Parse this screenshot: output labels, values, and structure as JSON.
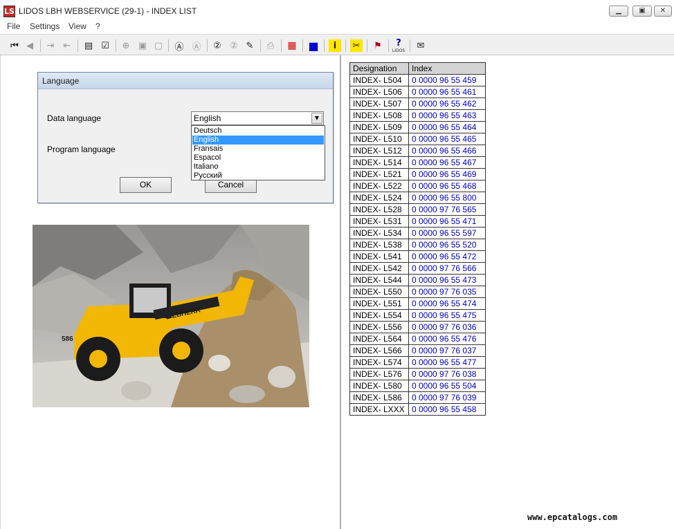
{
  "window": {
    "title": "LIDOS LBH WEBSERVICE (29-1) - INDEX LIST",
    "logo_text": "LS"
  },
  "menu": [
    "File",
    "Settings",
    "View",
    "?"
  ],
  "toolbar": {
    "icons": [
      "first-page-icon",
      "previous-page-icon",
      "export-icon",
      "import-icon",
      "cart-icon",
      "checklist-icon",
      "zoom-in-icon",
      "fit-page-icon",
      "page-icon",
      "find-a-icon",
      "find-next-icon",
      "goto-2-icon",
      "goto-alt-icon",
      "edit-icon",
      "print-icon",
      "grid-icon",
      "blue-square-icon",
      "info-icon",
      "tools-icon",
      "flag-icon",
      "lidos-help-icon",
      "mail-icon"
    ],
    "lidos_label": "LIDOS"
  },
  "dialog": {
    "title": "Language",
    "data_language_label": "Data language",
    "program_language_label": "Program language",
    "selected_value": "English",
    "options": [
      "Deutsch",
      "English",
      "Fransais",
      "Espacol",
      "Italiano",
      "Русский"
    ],
    "selected_index": 1,
    "ok_label": "OK",
    "cancel_label": "Cancel"
  },
  "photo": {
    "brand_text": "LIEBHERR",
    "model_text": "586"
  },
  "index_table": {
    "headers": [
      "Designation",
      "Index"
    ],
    "rows": [
      [
        "INDEX- L504",
        "0 0000 96 55 459"
      ],
      [
        "INDEX- L506",
        "0 0000 96 55 461"
      ],
      [
        "INDEX- L507",
        "0 0000 96 55 462"
      ],
      [
        "INDEX- L508",
        "0 0000 96 55 463"
      ],
      [
        "INDEX- L509",
        "0 0000 96 55 464"
      ],
      [
        "INDEX- L510",
        "0 0000 96 55 465"
      ],
      [
        "INDEX- L512",
        "0 0000 96 55 466"
      ],
      [
        "INDEX- L514",
        "0 0000 96 55 467"
      ],
      [
        "INDEX- L521",
        "0 0000 96 55 469"
      ],
      [
        "INDEX- L522",
        "0 0000 96 55 468"
      ],
      [
        "INDEX- L524",
        "0 0000 96 55 800"
      ],
      [
        "INDEX- L528",
        "0 0000 97 76 565"
      ],
      [
        "INDEX- L531",
        "0 0000 96 55 471"
      ],
      [
        "INDEX- L534",
        "0 0000 96 55 597"
      ],
      [
        "INDEX- L538",
        "0 0000 96 55 520"
      ],
      [
        "INDEX- L541",
        "0 0000 96 55 472"
      ],
      [
        "INDEX- L542",
        "0 0000 97 76 566"
      ],
      [
        "INDEX- L544",
        "0 0000 96 55 473"
      ],
      [
        "INDEX- L550",
        "0 0000 97 76 035"
      ],
      [
        "INDEX- L551",
        "0 0000 96 55 474"
      ],
      [
        "INDEX- L554",
        "0 0000 96 55 475"
      ],
      [
        "INDEX- L556",
        "0 0000 97 76 036"
      ],
      [
        "INDEX- L564",
        "0 0000 96 55 476"
      ],
      [
        "INDEX- L566",
        "0 0000 97 76 037"
      ],
      [
        "INDEX- L574",
        "0 0000 96 55 477"
      ],
      [
        "INDEX- L576",
        "0 0000 97 76 038"
      ],
      [
        "INDEX- L580",
        "0 0000 96 55 504"
      ],
      [
        "INDEX- L586",
        "0 0000 97 76 039"
      ],
      [
        "INDEX- LXXX",
        "0 0000 96 55 458"
      ]
    ]
  },
  "watermark": "www.epcatalogs.com",
  "colors": {
    "index_link": "#0000c0",
    "selection": "#3399ff",
    "header_bg": "#d4d4d4",
    "machine_yellow": "#f2b705"
  }
}
